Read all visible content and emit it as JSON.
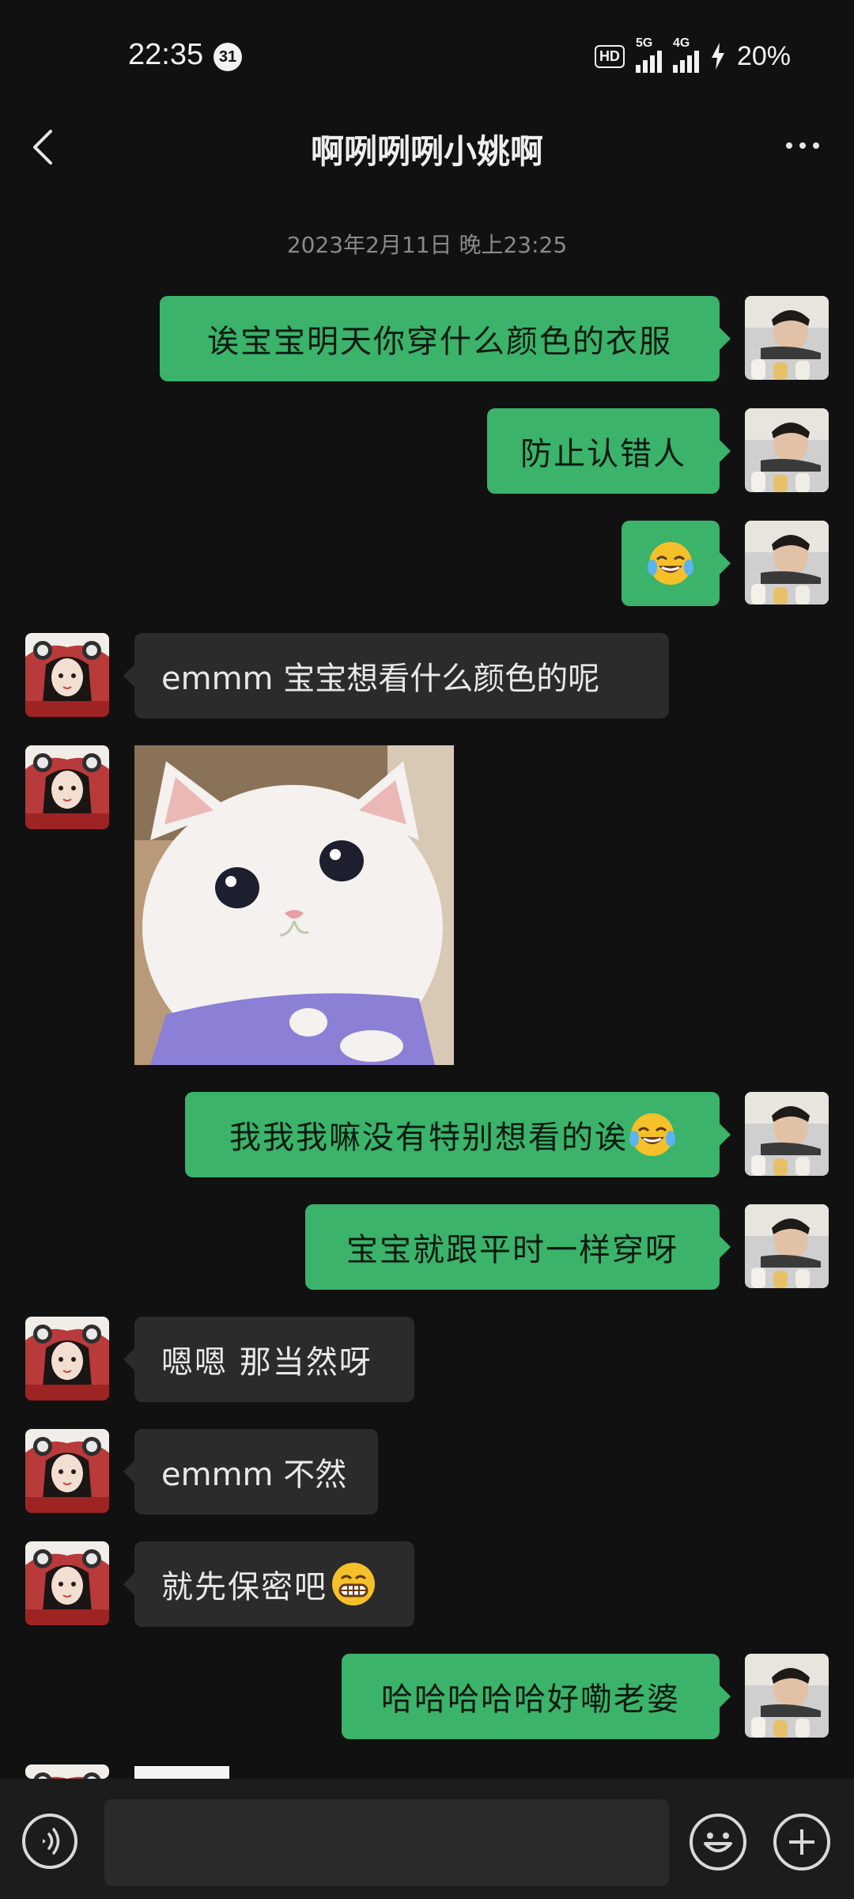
{
  "status_bar": {
    "time": "22:35",
    "notification_count": "31",
    "hd_label": "HD",
    "signal_1_label": "5G",
    "signal_2_label": "4G",
    "battery": "20%"
  },
  "header": {
    "title": "啊咧咧咧小姚啊"
  },
  "timestamp": "2023年2月11日 晚上23:25",
  "messages": [
    {
      "side": "out",
      "text": "诶宝宝明天你穿什么颜色的衣服"
    },
    {
      "side": "out",
      "text": "防止认错人"
    },
    {
      "side": "out",
      "emoji": "laughing-crying-emoji"
    },
    {
      "side": "in",
      "text": "emmm 宝宝想看什么颜色的呢"
    },
    {
      "side": "in",
      "image": "white-cat-photo"
    },
    {
      "side": "out",
      "text": "我我我嘛没有特别想看的诶",
      "emoji": "laughing-crying-emoji"
    },
    {
      "side": "out",
      "text": "宝宝就跟平时一样穿呀"
    },
    {
      "side": "in",
      "text": "嗯嗯 那当然呀"
    },
    {
      "side": "in",
      "text": "emmm 不然"
    },
    {
      "side": "in",
      "text": "就先保密吧",
      "emoji": "grinning-emoji"
    },
    {
      "side": "out",
      "text": "哈哈哈哈哈好嘞老婆"
    }
  ],
  "colors": {
    "background": "#111111",
    "outgoing_bubble": "#3bb36a",
    "incoming_bubble": "#2b2b2b"
  },
  "input_bar": {
    "placeholder": ""
  }
}
